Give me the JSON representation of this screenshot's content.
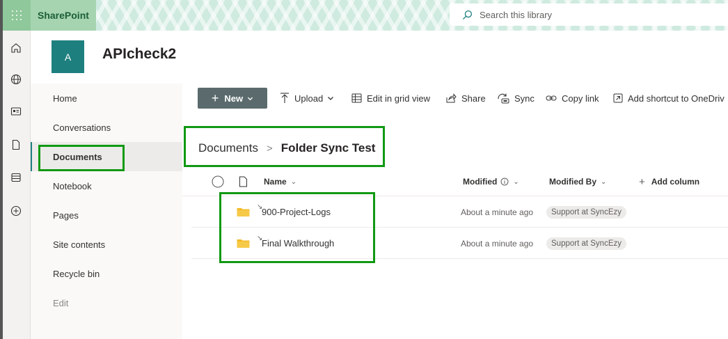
{
  "topbar": {
    "brand": "SharePoint",
    "search_placeholder": "Search this library"
  },
  "site": {
    "logo_letter": "A",
    "title": "APIcheck2"
  },
  "leftnav": {
    "items": [
      {
        "label": "Home"
      },
      {
        "label": "Conversations"
      },
      {
        "label": "Documents"
      },
      {
        "label": "Notebook"
      },
      {
        "label": "Pages"
      },
      {
        "label": "Site contents"
      },
      {
        "label": "Recycle bin"
      },
      {
        "label": "Edit"
      }
    ],
    "selected": "Documents"
  },
  "commandbar": {
    "new_label": "New",
    "upload_label": "Upload",
    "edit_grid_label": "Edit in grid view",
    "share_label": "Share",
    "sync_label": "Sync",
    "copy_link_label": "Copy link",
    "add_shortcut_label": "Add shortcut to OneDriv"
  },
  "breadcrumb": {
    "parent": "Documents",
    "separator": ">",
    "current": "Folder Sync Test"
  },
  "list": {
    "columns": {
      "name": "Name",
      "modified": "Modified",
      "modified_by": "Modified By",
      "add_column": "Add column"
    },
    "rows": [
      {
        "name": "900-Project-Logs",
        "modified": "About a minute ago",
        "modified_by": "Support at SyncEzy"
      },
      {
        "name": "Final Walkthrough",
        "modified": "About a minute ago",
        "modified_by": "Support at SyncEzy"
      }
    ]
  },
  "colors": {
    "accent": "#1e7f7f",
    "new_button": "#5b6b6d",
    "highlight": "#119913",
    "folder": "#f2bb29"
  }
}
